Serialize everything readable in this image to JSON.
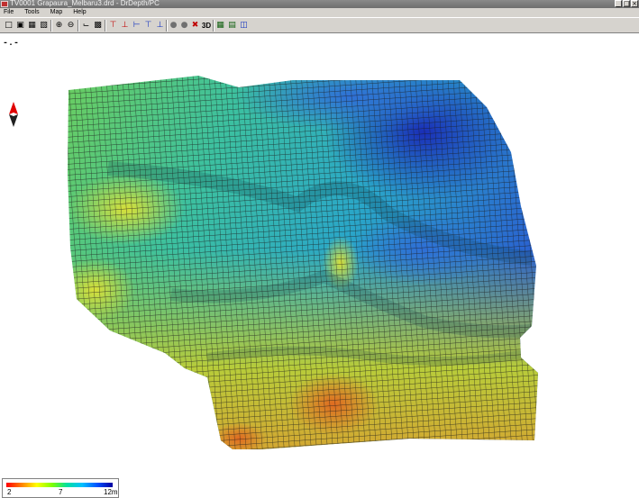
{
  "window": {
    "title": "TV0001 Grapaura_Melbaru3.drd - DrDepth/PC",
    "buttons": [
      "_",
      "□",
      "×"
    ]
  },
  "menu": {
    "file": "File",
    "tools": "Tools",
    "map": "Map",
    "help": "Help"
  },
  "toolbar": {
    "view3d_label": "3D"
  },
  "status": {
    "coordinate_readout": "-.-"
  },
  "legend": {
    "min_label": "2",
    "mid_label": "7",
    "max_label": "12m",
    "colors": [
      "#ff0000",
      "#ff8000",
      "#ffff00",
      "#80ff00",
      "#00e0a0",
      "#00c0ff",
      "#0050ff",
      "#0000a0"
    ]
  },
  "colors": {
    "mesh_line": "#1a1a1a",
    "deep_blue": "#1f3fbf",
    "teal": "#3fbfa6",
    "yellow": "#c8d23c",
    "orange": "#e08a2a"
  }
}
